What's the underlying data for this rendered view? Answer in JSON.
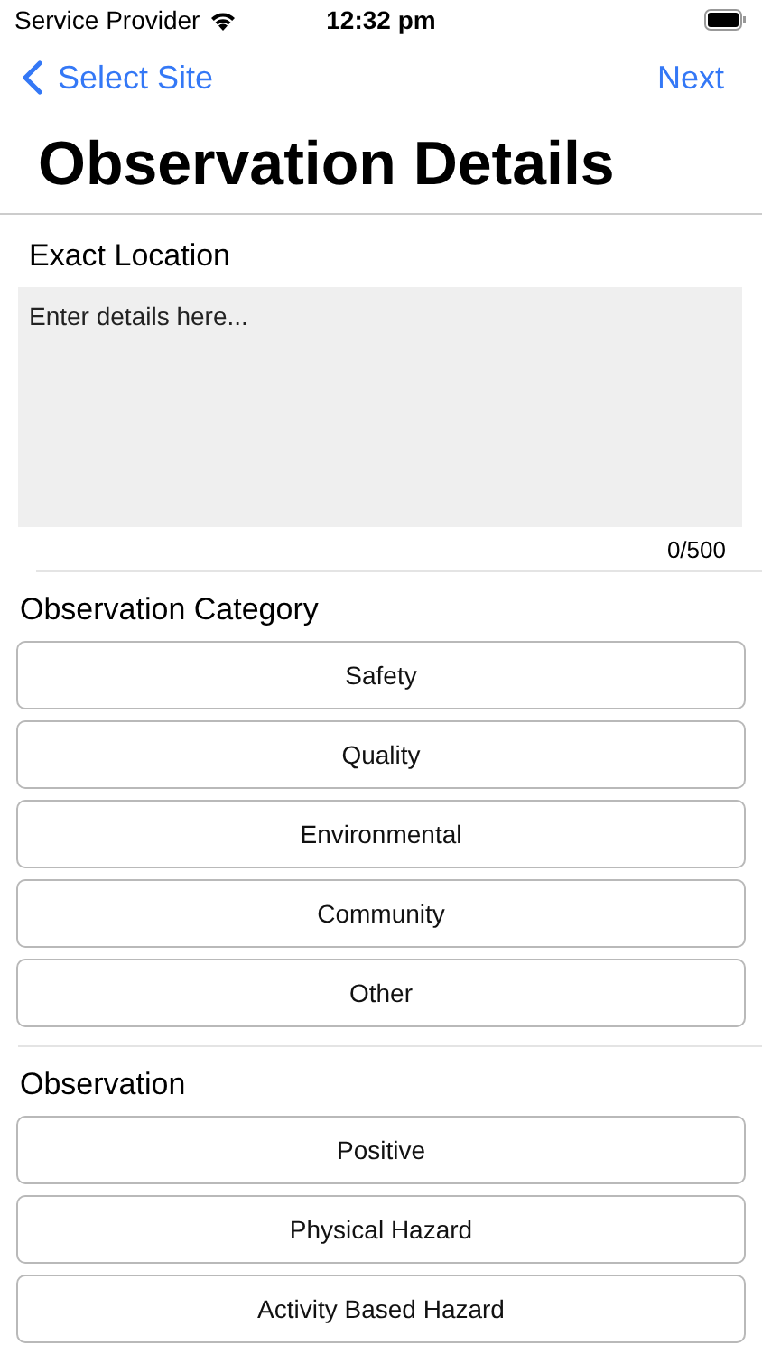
{
  "status_bar": {
    "carrier": "Service Provider",
    "time": "12:32 pm"
  },
  "nav": {
    "back": "Select Site",
    "next": "Next"
  },
  "title": "Observation Details",
  "location": {
    "label": "Exact Location",
    "placeholder": "Enter details here...",
    "counter": "0/500"
  },
  "sections": [
    {
      "label": "Observation Category",
      "options": [
        "Safety",
        "Quality",
        "Environmental",
        "Community",
        "Other"
      ]
    },
    {
      "label": "Observation",
      "options": [
        "Positive",
        "Physical Hazard",
        "Activity Based Hazard"
      ]
    }
  ]
}
